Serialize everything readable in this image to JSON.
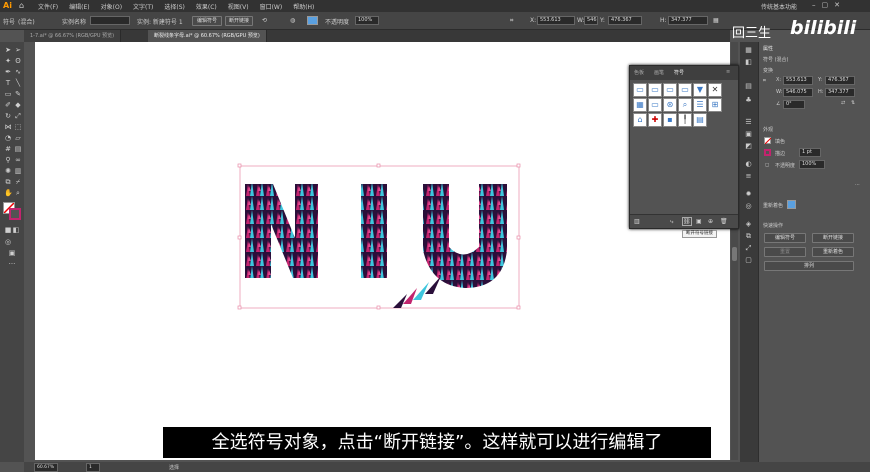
{
  "app": {
    "logo": "Ai",
    "workspace": "传统基本功能"
  },
  "menu": [
    "文件(F)",
    "编辑(E)",
    "对象(O)",
    "文字(T)",
    "选择(S)",
    "效果(C)",
    "视图(V)",
    "窗口(W)",
    "帮助(H)"
  ],
  "control_bar": {
    "obj_type": "符号",
    "mixed": "(混合)",
    "instance_name_label": "实例名称",
    "instance_of": "实例: 新建符号 1",
    "edit_symbol": "编辑符号",
    "break_link": "断开链接",
    "opacity_label": "不透明度",
    "opacity": "100%",
    "x": "553.613",
    "y": "476.367",
    "w": "546.075",
    "h": "347.377"
  },
  "tabs": [
    "1-7.ai* @ 66.67% (RGB/GPU 预览)",
    "断裂线条字母.ai* @ 60.67% (RGB/GPU 预览)"
  ],
  "symbols_panel": {
    "tabs": [
      "色板",
      "画笔",
      "符号"
    ],
    "tooltip": "断开符号链接"
  },
  "artwork": {
    "letters": "NIU",
    "colors": {
      "cyan": "#3ec6de",
      "magenta": "#c2246e",
      "dark": "#2a0f3a"
    }
  },
  "right_panel": {
    "title": "属性",
    "symbol_label": "符号 (混合)",
    "transform_label": "变换",
    "x": "553.613",
    "y": "476.367",
    "w": "546.075",
    "h": "347.377",
    "angle": "0°",
    "appearance_label": "外观",
    "fill_label": "填色",
    "stroke_label": "描边",
    "stroke_val": "1 pt",
    "opacity_label": "不透明度",
    "opacity_val": "100%",
    "quick_label": "快速操作",
    "actions": [
      "编辑符号",
      "断开链接",
      "重置",
      "重新着色",
      "排列"
    ]
  },
  "status": {
    "zoom": "60.67%",
    "page": "1",
    "tool": "选择"
  },
  "subtitle": "全选符号对象，点击“断开链接”。这样就可以进行编辑了",
  "watermark": {
    "up": "回三生",
    "brand": "bilibili"
  }
}
